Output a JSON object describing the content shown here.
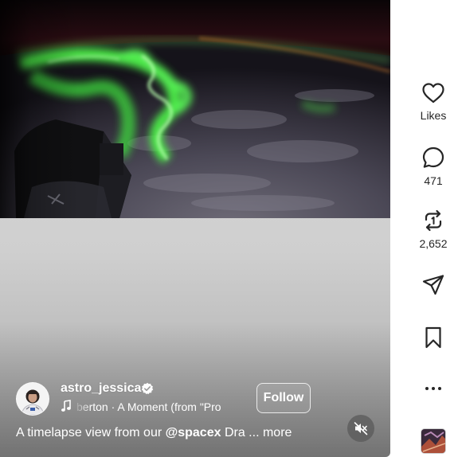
{
  "post": {
    "username": "astro_jessica",
    "verified": true,
    "audio": "berton · A Moment (from \"Pro",
    "follow_label": "Follow",
    "caption_text": "A timelapse view from our ",
    "caption_mention": "@spacex",
    "caption_after": " Dra",
    "caption_ellipsis": " ... ",
    "caption_more": "more",
    "muted": true
  },
  "actions": {
    "likes_label": "Likes",
    "comments_count": "471",
    "reposts_count": "2,652"
  },
  "icons": {
    "like": "heart-icon",
    "comment": "comment-bubble-icon",
    "repost": "repost-icon",
    "share": "paper-plane-icon",
    "save": "bookmark-icon",
    "more": "more-dots-icon",
    "audio": "audio-cover-thumbnail",
    "verified": "verified-badge-icon",
    "music": "music-note-icon",
    "mute": "speaker-muted-icon"
  },
  "colors": {
    "aurora": "#5cff5a",
    "rail_text": "#262626",
    "overlay_text": "#ffffff"
  }
}
